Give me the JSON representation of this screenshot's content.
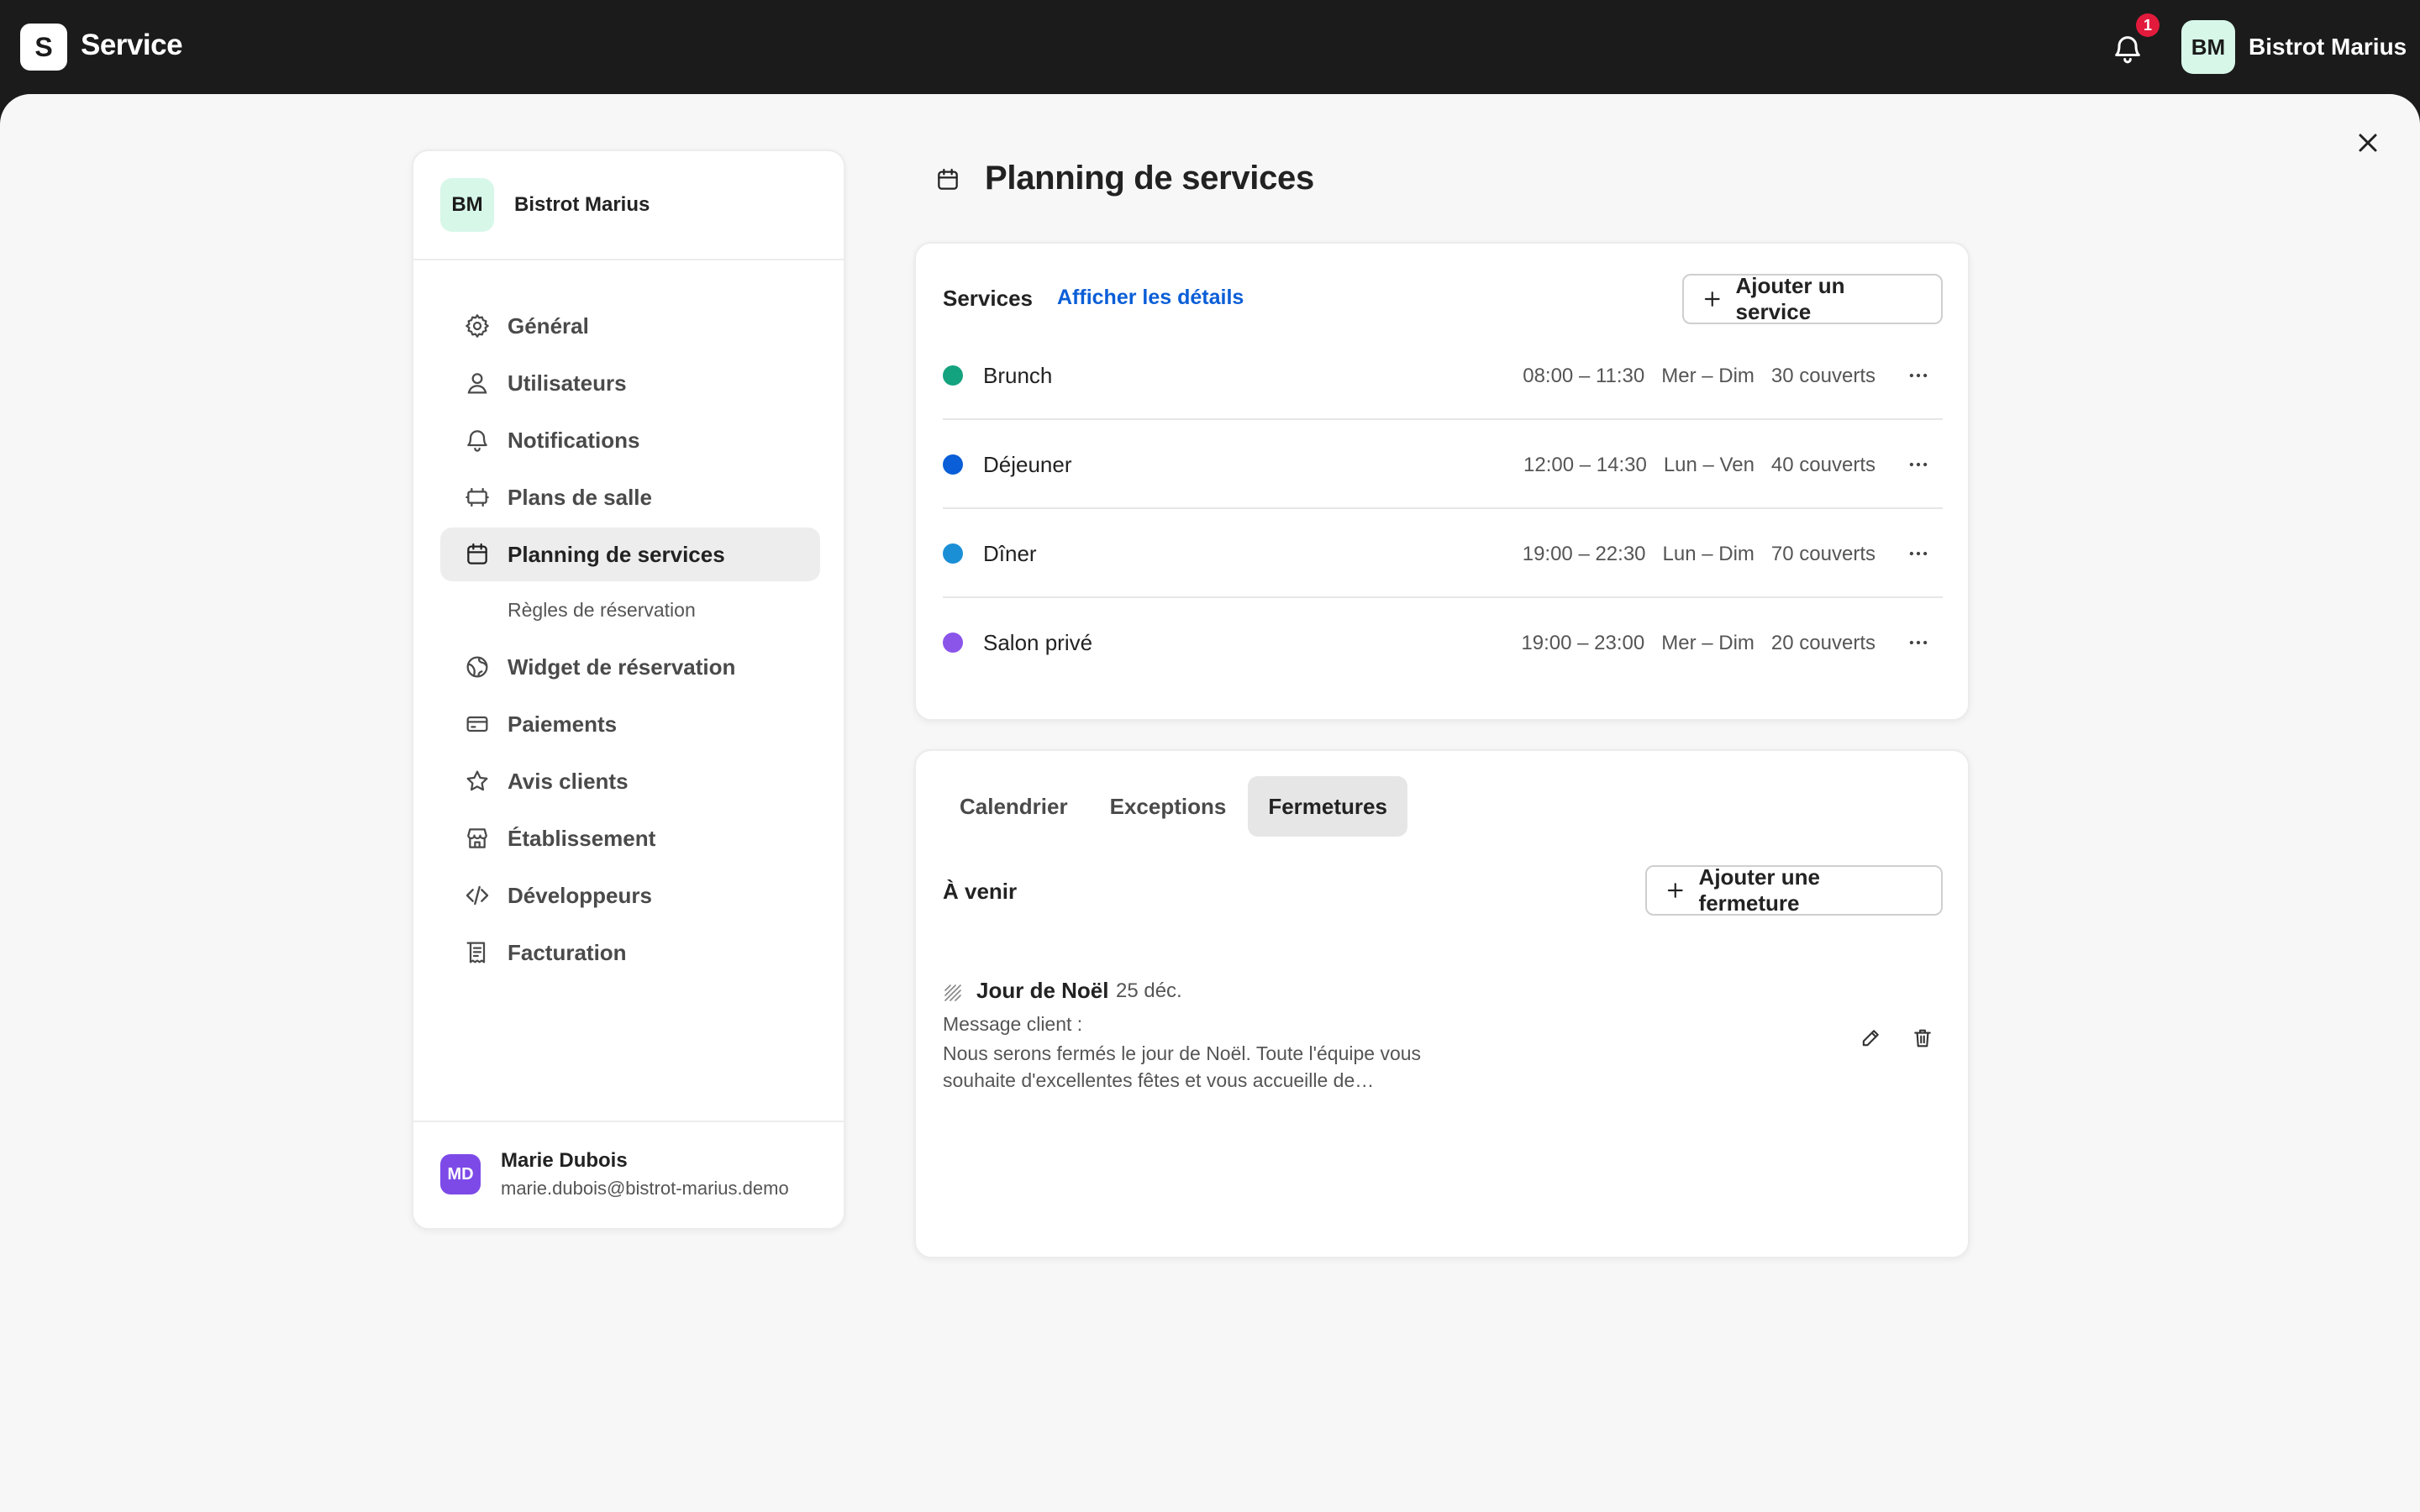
{
  "app": {
    "logo_letter": "S",
    "name": "Service",
    "notification_count": "1",
    "account_initials": "BM",
    "account_name": "Bistrot Marius"
  },
  "sidebar": {
    "org_initials": "BM",
    "org_name": "Bistrot Marius",
    "items": [
      {
        "label": "Général",
        "icon": "gear-icon"
      },
      {
        "label": "Utilisateurs",
        "icon": "user-icon"
      },
      {
        "label": "Notifications",
        "icon": "bell-icon"
      },
      {
        "label": "Plans de salle",
        "icon": "floor-plan-icon"
      },
      {
        "label": "Planning de services",
        "icon": "calendar-icon",
        "active": true
      },
      {
        "label": "Widget de réservation",
        "icon": "globe-icon"
      },
      {
        "label": "Paiements",
        "icon": "credit-card-icon"
      },
      {
        "label": "Avis clients",
        "icon": "star-icon"
      },
      {
        "label": "Établissement",
        "icon": "store-icon"
      },
      {
        "label": "Développeurs",
        "icon": "code-icon"
      },
      {
        "label": "Facturation",
        "icon": "receipt-icon"
      }
    ],
    "sub_item": "Règles de réservation",
    "user": {
      "initials": "MD",
      "name": "Marie Dubois",
      "email": "marie.dubois@bistrot-marius.demo"
    }
  },
  "main": {
    "title": "Planning de services",
    "services": {
      "title": "Services",
      "details_link": "Afficher les détails",
      "add_button": "Ajouter un service",
      "rows": [
        {
          "name": "Brunch",
          "hours": "08:00 – 11:30",
          "days": "Mer – Dim",
          "covers": "30 couverts",
          "color": "#14a37f"
        },
        {
          "name": "Déjeuner",
          "hours": "12:00 – 14:30",
          "days": "Lun – Ven",
          "covers": "40 couverts",
          "color": "#0a5ed7"
        },
        {
          "name": "Dîner",
          "hours": "19:00 – 22:30",
          "days": "Lun – Dim",
          "covers": "70 couverts",
          "color": "#1a8fd6"
        },
        {
          "name": "Salon privé",
          "hours": "19:00 – 23:00",
          "days": "Mer – Dim",
          "covers": "20 couverts",
          "color": "#8b55ea"
        }
      ]
    },
    "tabs": [
      {
        "label": "Calendrier"
      },
      {
        "label": "Exceptions"
      },
      {
        "label": "Fermetures",
        "active": true
      }
    ],
    "closures": {
      "section_title": "À venir",
      "add_button": "Ajouter une fermeture",
      "items": [
        {
          "name": "Jour de Noël",
          "date": "25 déc.",
          "message_label": "Message client :",
          "message": "Nous serons fermés le jour de Noël. Toute l'équipe vous souhaite d'excellentes fêtes et vous accueille de…"
        }
      ]
    }
  }
}
